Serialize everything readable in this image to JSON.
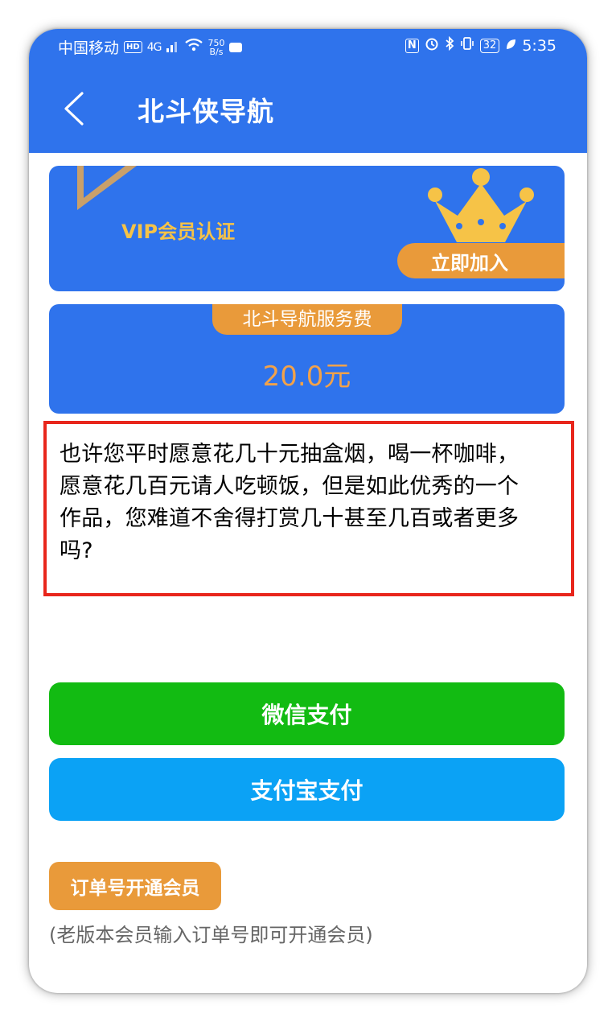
{
  "status_bar": {
    "carrier": "中国移动",
    "hd": "HD",
    "network": "4G",
    "speed_value": "750",
    "speed_unit": "B/s",
    "nfc": "N",
    "battery": "32",
    "time": "5:35"
  },
  "app_bar": {
    "title": "北斗侠导航"
  },
  "vip_card": {
    "label": "VIP会员认证",
    "join_label": "立即加入"
  },
  "fee_card": {
    "label": "北斗导航服务费",
    "amount": "20.0元"
  },
  "message": {
    "text": "也许您平时愿意花几十元抽盒烟，喝一杯咖啡，愿意花几百元请人吃顿饭，但是如此优秀的一个作品，您难道不舍得打赏几十甚至几百或者更多吗?"
  },
  "payment": {
    "wechat_label": "微信支付",
    "alipay_label": "支付宝支付"
  },
  "order": {
    "button_label": "订单号开通会员",
    "note": "(老版本会员输入订单号即可开通会员)"
  },
  "colors": {
    "primary_blue": "#2f73ec",
    "orange": "#e99a3a",
    "vip_gold": "#f6c347",
    "wechat_green": "#12bb12",
    "alipay_blue": "#0ba2f5",
    "highlight_red": "#e8261c"
  },
  "icons": [
    "back-arrow-icon",
    "crown-icon",
    "wifi-icon",
    "signal-icon",
    "bluetooth-icon",
    "alarm-icon",
    "vibrate-icon",
    "leaf-icon"
  ]
}
